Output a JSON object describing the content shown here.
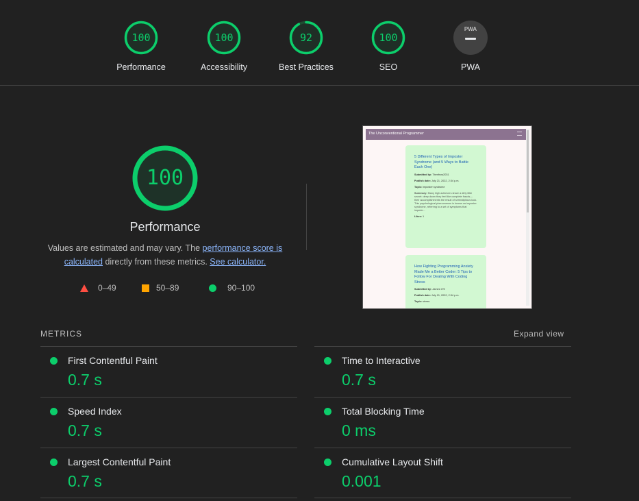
{
  "categories": [
    {
      "label": "Performance",
      "score": "100",
      "value": 100
    },
    {
      "label": "Accessibility",
      "score": "100",
      "value": 100
    },
    {
      "label": "Best Practices",
      "score": "92",
      "value": 92
    },
    {
      "label": "SEO",
      "score": "100",
      "value": 100
    },
    {
      "label": "PWA",
      "badge": "PWA"
    }
  ],
  "performance": {
    "score": "100",
    "value": 100,
    "title": "Performance",
    "desc_prefix": "Values are estimated and may vary. The ",
    "desc_link1": "performance score is calculated",
    "desc_middle": " directly from these metrics. ",
    "desc_link2": "See calculator."
  },
  "legend": [
    {
      "range": "0–49",
      "color": "#ff4e42"
    },
    {
      "range": "50–89",
      "color": "#ffa400"
    },
    {
      "range": "90–100",
      "color": "#0cce6b"
    }
  ],
  "thumbnail": {
    "site_title": "The Unconventional Programmer",
    "cards": [
      {
        "title": "5 Different Types of Imposter Syndrome (and 5 Ways to Battle Each One)",
        "submitted_label": "Submitted by:",
        "submitted_value": "Tbenfrow2031",
        "date_label": "Publish date:",
        "date_value": "July 21, 2022, 2:34 p.m.",
        "topic_label": "Topic:",
        "topic_value": "imposter syndrome",
        "summary_label": "Summary:",
        "summary_value": "Many high achievers share a dirty little secret: deep down they feel like complete frauds—their accomplishments the result of serendipitous luck. This psychological phenomenon is known as imposter syndrome, referring to a set of symptoms that impede...",
        "likes_label": "Likes:",
        "likes_value": "1"
      },
      {
        "title": "How Fighting Programming Anxiety Made Me a Better Coder: 5 Tips to Follow For Dealing With Coding Stress",
        "submitted_label": "Submitted by:",
        "submitted_value": "James O'S",
        "date_label": "Publish date:",
        "date_value": "July 21, 2022, 2:34 p.m.",
        "topic_label": "Topic:",
        "topic_value": "stress"
      }
    ]
  },
  "metrics": {
    "label": "METRICS",
    "expand_label": "Expand view",
    "items": [
      {
        "name": "First Contentful Paint",
        "value": "0.7 s"
      },
      {
        "name": "Time to Interactive",
        "value": "0.7 s"
      },
      {
        "name": "Speed Index",
        "value": "0.7 s"
      },
      {
        "name": "Total Blocking Time",
        "value": "0 ms"
      },
      {
        "name": "Largest Contentful Paint",
        "value": "0.7 s"
      },
      {
        "name": "Cumulative Layout Shift",
        "value": "0.001"
      }
    ]
  },
  "colors": {
    "pass": "#0cce6b",
    "average": "#ffa400",
    "fail": "#ff4e42",
    "background": "#212121"
  }
}
